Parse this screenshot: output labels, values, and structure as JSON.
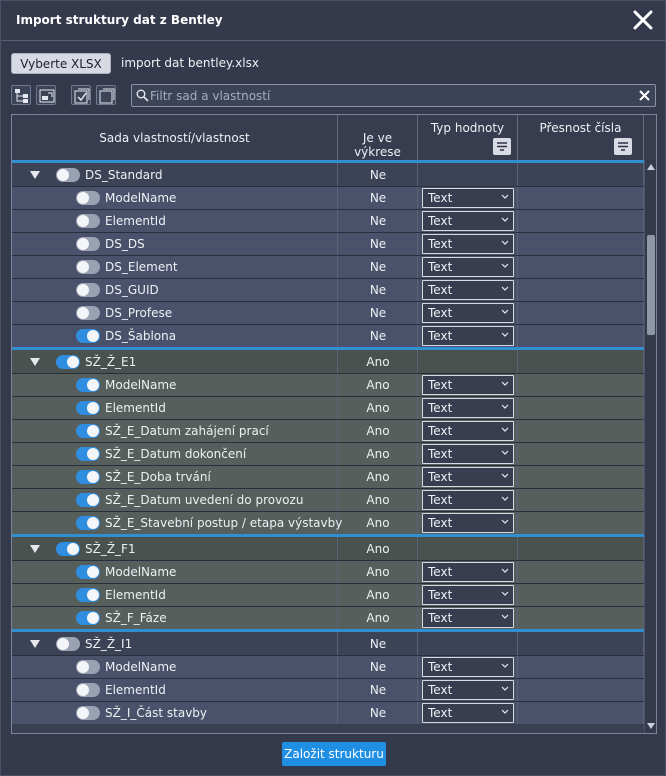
{
  "dialog": {
    "title": "Import struktury dat z Bentley",
    "select_button": "Vyberte XLSX",
    "file_name": "import dat bentley.xlsx",
    "filter_placeholder": "Filtr sad a vlastností",
    "create_button": "Založit strukturu"
  },
  "columns": {
    "name": "Sada vlastností/vlastnost",
    "in_drawing": "Je ve výkrese",
    "value_type": "Typ hodnoty",
    "precision": "Přesnost čísla"
  },
  "colors": {
    "accent": "#2f8fd0",
    "group_std_bg": "#3c4356",
    "group_alt_bg": "#4a5250",
    "child_std_bg": "#4a526b",
    "child_alt_bg": "#565f5c"
  },
  "rows": [
    {
      "kind": "group",
      "label": "DS_Standard",
      "in_drawing": "Ne",
      "on": false,
      "tone": "std"
    },
    {
      "kind": "prop",
      "label": "ModelName",
      "in_drawing": "Ne",
      "type": "Text",
      "on": false,
      "tone": "std"
    },
    {
      "kind": "prop",
      "label": "ElementId",
      "in_drawing": "Ne",
      "type": "Text",
      "on": false,
      "tone": "std"
    },
    {
      "kind": "prop",
      "label": "DS_DS",
      "in_drawing": "Ne",
      "type": "Text",
      "on": false,
      "tone": "std"
    },
    {
      "kind": "prop",
      "label": "DS_Element",
      "in_drawing": "Ne",
      "type": "Text",
      "on": false,
      "tone": "std"
    },
    {
      "kind": "prop",
      "label": "DS_GUID",
      "in_drawing": "Ne",
      "type": "Text",
      "on": false,
      "tone": "std"
    },
    {
      "kind": "prop",
      "label": "DS_Profese",
      "in_drawing": "Ne",
      "type": "Text",
      "on": false,
      "tone": "std"
    },
    {
      "kind": "prop",
      "label": "DS_Šablona",
      "in_drawing": "Ne",
      "type": "Text",
      "on": true,
      "tone": "std"
    },
    {
      "kind": "group",
      "label": "SŽ_Ž_E1",
      "in_drawing": "Ano",
      "on": true,
      "tone": "alt"
    },
    {
      "kind": "prop",
      "label": "ModelName",
      "in_drawing": "Ano",
      "type": "Text",
      "on": true,
      "tone": "alt"
    },
    {
      "kind": "prop",
      "label": "ElementId",
      "in_drawing": "Ano",
      "type": "Text",
      "on": true,
      "tone": "alt"
    },
    {
      "kind": "prop",
      "label": "SŽ_E_Datum zahájení prací",
      "in_drawing": "Ano",
      "type": "Text",
      "on": true,
      "tone": "alt"
    },
    {
      "kind": "prop",
      "label": "SŽ_E_Datum dokončení",
      "in_drawing": "Ano",
      "type": "Text",
      "on": true,
      "tone": "alt"
    },
    {
      "kind": "prop",
      "label": "SŽ_E_Doba trvání",
      "in_drawing": "Ano",
      "type": "Text",
      "on": true,
      "tone": "alt"
    },
    {
      "kind": "prop",
      "label": "SŽ_E_Datum uvedení do provozu",
      "in_drawing": "Ano",
      "type": "Text",
      "on": true,
      "tone": "alt"
    },
    {
      "kind": "prop",
      "label": "SŽ_E_Stavební postup / etapa výstavby",
      "in_drawing": "Ano",
      "type": "Text",
      "on": true,
      "tone": "alt"
    },
    {
      "kind": "group",
      "label": "SŽ_Ž_F1",
      "in_drawing": "Ano",
      "on": true,
      "tone": "alt"
    },
    {
      "kind": "prop",
      "label": "ModelName",
      "in_drawing": "Ano",
      "type": "Text",
      "on": true,
      "tone": "alt"
    },
    {
      "kind": "prop",
      "label": "ElementId",
      "in_drawing": "Ano",
      "type": "Text",
      "on": true,
      "tone": "alt"
    },
    {
      "kind": "prop",
      "label": "SŽ_F_Fáze",
      "in_drawing": "Ano",
      "type": "Text",
      "on": true,
      "tone": "alt"
    },
    {
      "kind": "group",
      "label": "SŽ_Ž_I1",
      "in_drawing": "Ne",
      "on": false,
      "tone": "std"
    },
    {
      "kind": "prop",
      "label": "ModelName",
      "in_drawing": "Ne",
      "type": "Text",
      "on": false,
      "tone": "std"
    },
    {
      "kind": "prop",
      "label": "ElementId",
      "in_drawing": "Ne",
      "type": "Text",
      "on": false,
      "tone": "std"
    },
    {
      "kind": "prop",
      "label": "SŽ_I_Část stavby",
      "in_drawing": "Ne",
      "type": "Text",
      "on": false,
      "tone": "std"
    }
  ]
}
